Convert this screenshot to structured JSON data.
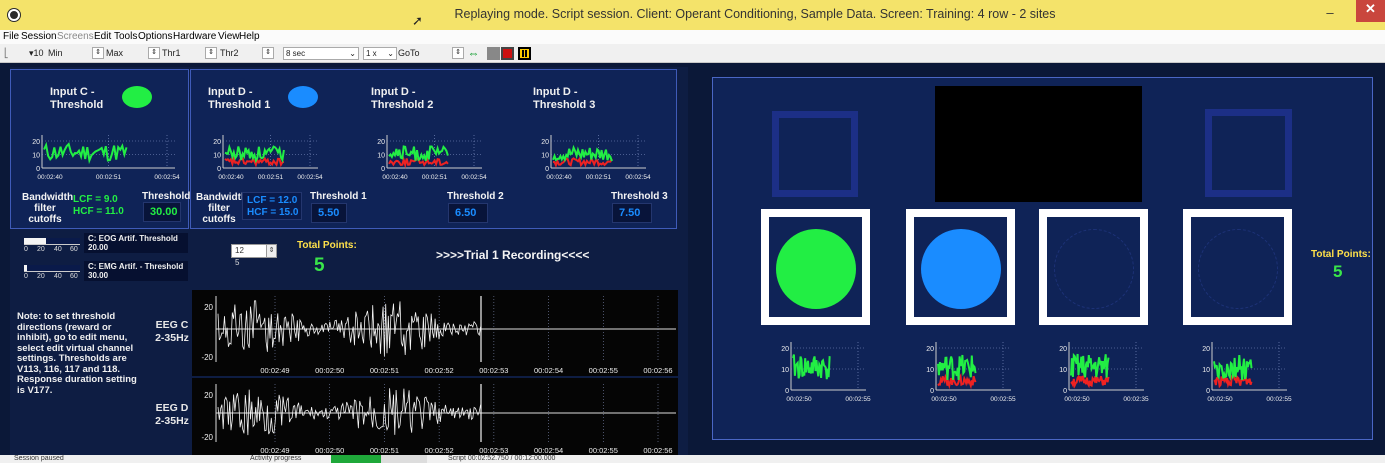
{
  "window": {
    "title": "Replaying mode. Script session. Client: Operant Conditioning, Sample Data. Screen: Training: 4 row - 2 sites",
    "minimize": "–",
    "maximize": "□",
    "close": "✕"
  },
  "menu": [
    "File",
    "Session",
    "Screens",
    "Edit",
    "Tools",
    "Options",
    "Hardware",
    "View",
    "Help"
  ],
  "toolbar": {
    "value": "10",
    "min_label": "Min",
    "max_label": "Max",
    "thr1_label": "Thr1",
    "thr2_label": "Thr2",
    "epoch_value": "8 sec",
    "speed_value": "1 x",
    "goto_label": "GoTo"
  },
  "site_c": {
    "title": "Input C -\nThreshold",
    "led_color": "#22ee44",
    "chart": {
      "ymax": "20",
      "ymid": "10",
      "ymin": "0",
      "times": [
        "00:02:40",
        "00:02:51",
        "00:02:54"
      ]
    },
    "bandwidth_label": "Bandwidth\nfilter\ncutoffs",
    "lcf": "LCF = 9.0",
    "hcf": "HCF = 11.0",
    "threshold_label": "Threshold",
    "threshold_value": "30.00"
  },
  "site_d": {
    "title": "Input D -\nThreshold 1",
    "led_color": "#1a8cff",
    "chart": {
      "ymax": "20",
      "ymid": "10",
      "ymin": "0",
      "times": [
        "00:02:40",
        "00:02:51",
        "00:02:54"
      ]
    },
    "bandwidth_label": "Bandwidth\nfilter\ncutoffs",
    "lcf": "LCF = 12.0",
    "hcf": "HCF = 15.0",
    "threshold_label": "Threshold 1",
    "threshold_value": "5.50"
  },
  "site_d2": {
    "title": "Input D -\nThreshold 2",
    "chart": {
      "ymax": "20",
      "ymid": "10",
      "ymin": "0",
      "times": [
        "00:02:40",
        "00:02:51",
        "00:02:54"
      ]
    },
    "threshold_label": "Threshold 2",
    "threshold_value": "6.50"
  },
  "site_d3": {
    "title": "Input D -\nThreshold 3",
    "chart": {
      "ymax": "20",
      "ymid": "10",
      "ymin": "0",
      "times": [
        "00:02:40",
        "00:02:51",
        "00:02:54"
      ]
    },
    "threshold_label": "Threshold 3",
    "threshold_value": "7.50"
  },
  "artifacts": {
    "scale": [
      "0",
      "20",
      "40",
      "60"
    ],
    "eog_label": "C: EOG Artif.  Threshold",
    "eog_value": "20.00",
    "emg_label": "C: EMG Artif. - Threshold",
    "emg_value": "30.00",
    "eog_level": 0.4,
    "emg_level": 0.05
  },
  "duration": {
    "value": "12",
    "sub": "5"
  },
  "points_left": {
    "label": "Total Points:",
    "value": "5"
  },
  "trial_text": ">>>>Trial 1 Recording<<<<",
  "note": "Note: to set threshold directions (reward or inhibit), go to edit menu, select edit virtual channel settings. Thresholds are V113, 116, 117 and 118. Response duration setting is V177.",
  "eeg": [
    {
      "label": "EEG C\n2-35Hz",
      "ymax": "20",
      "ymin": "-20",
      "times": [
        "00:02:49",
        "00:02:50",
        "00:02:51",
        "00:02:52",
        "00:02:53",
        "00:02:54",
        "00:02:55",
        "00:02:56"
      ]
    },
    {
      "label": "EEG D\n2-35Hz",
      "ymax": "20",
      "ymin": "-20",
      "times": [
        "00:02:49",
        "00:02:50",
        "00:02:51",
        "00:02:52",
        "00:02:53",
        "00:02:54",
        "00:02:55",
        "00:02:56"
      ]
    }
  ],
  "status": {
    "left": "Session paused",
    "activity": "Activity progress",
    "progress": 0.52,
    "script": "Script 00:02:52.750 / 00:12:00.000"
  },
  "feedback": {
    "circles": [
      "#22ee44",
      "#1a8cff"
    ],
    "points_label": "Total Points:",
    "points_value": "5",
    "charts": [
      {
        "ymax": "20",
        "ymid": "10",
        "ymin": "0",
        "times": [
          "00:02:50",
          "00:02:55"
        ]
      },
      {
        "ymax": "20",
        "ymid": "10",
        "ymin": "0",
        "times": [
          "00:02:50",
          "00:02:55"
        ]
      },
      {
        "ymax": "20",
        "ymid": "10",
        "ymin": "0",
        "times": [
          "00:02:50",
          "00:02:35"
        ]
      },
      {
        "ymax": "20",
        "ymid": "10",
        "ymin": "0",
        "times": [
          "00:02:50",
          "00:02:55"
        ]
      }
    ]
  }
}
